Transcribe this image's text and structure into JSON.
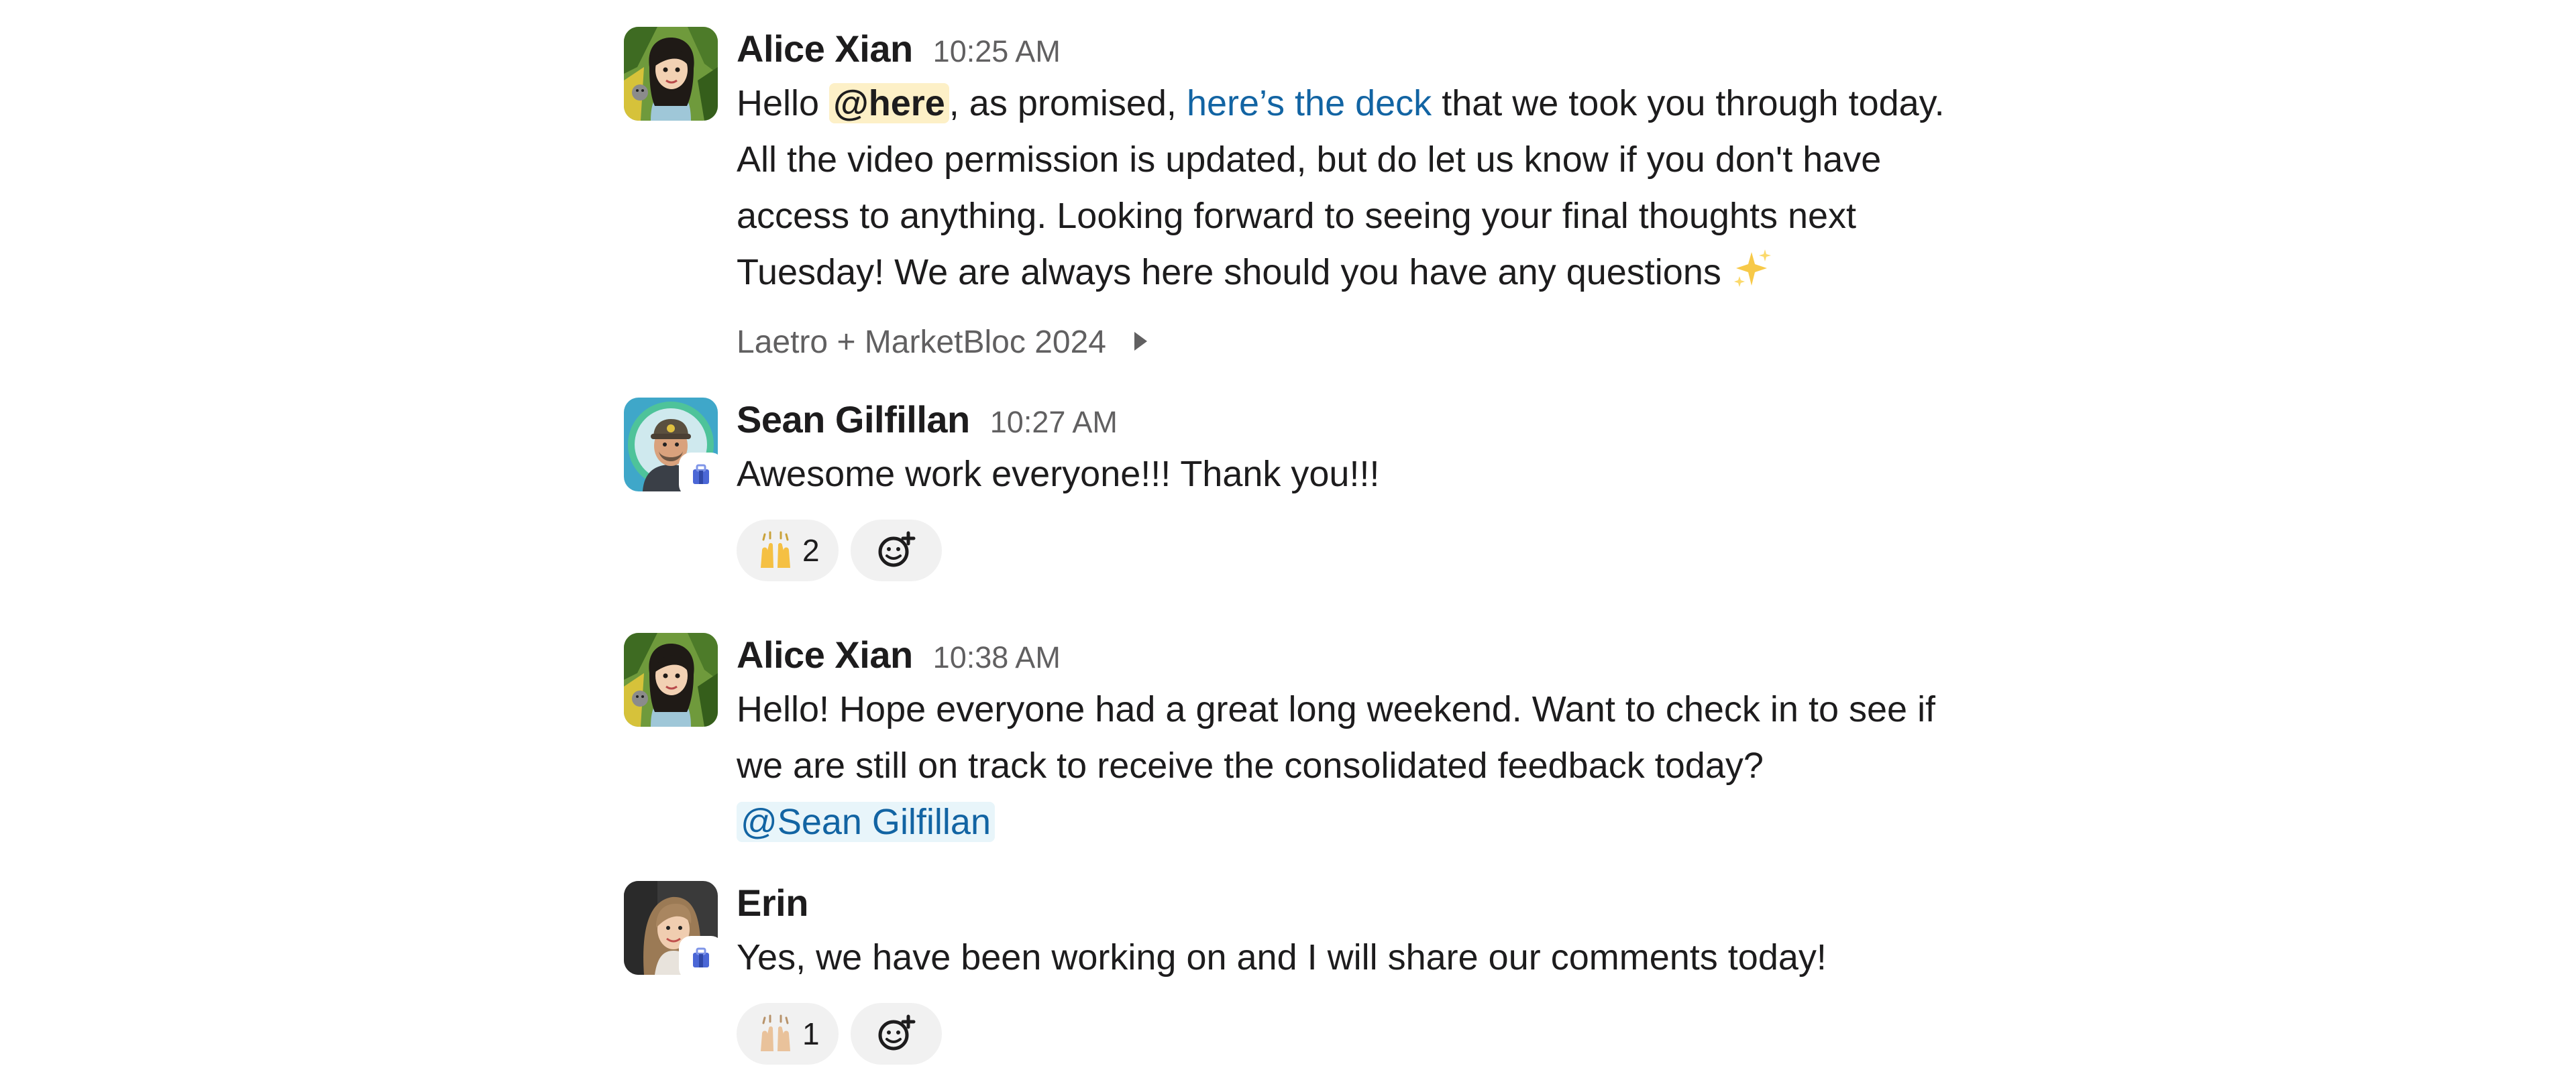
{
  "messages": [
    {
      "author": "Alice Xian",
      "time": "10:25 AM",
      "avatar": "alice-avatar",
      "text_pre": "Hello ",
      "mention": "@here",
      "text_mid": ", as promised, ",
      "link": "here’s the deck",
      "text_post": " that we took you through today. All the video permission is updated, but do let us know if you don't have access to anything. Looking forward to seeing your final thoughts next Tuesday! We are always here should you have any questions ",
      "emoji": "sparkles-icon",
      "attachment": "Laetro + MarketBloc 2024"
    },
    {
      "author": "Sean Gilfillan",
      "time": "10:27 AM",
      "avatar": "sean-avatar",
      "text": "Awesome work everyone!!! Thank you!!!",
      "reactions": [
        {
          "emoji": "raised-hands-icon",
          "count": "2"
        }
      ]
    },
    {
      "author": "Alice Xian",
      "time": "10:38 AM",
      "avatar": "alice-avatar",
      "text": "Hello! Hope everyone had a great long weekend. Want to check in to see if we are still on track to receive the consolidated feedback today?",
      "mention": "@Sean Gilfillan"
    },
    {
      "author": "Erin",
      "avatar": "erin-avatar",
      "text": "Yes, we have been working on and I will share our comments today!",
      "reactions": [
        {
          "emoji": "raised-hands-light-icon",
          "count": "1"
        }
      ]
    }
  ],
  "colors": {
    "text": "#1d1c1d",
    "muted": "#616061",
    "link": "#1264a3",
    "here_mention_bg": "#fdf0c7",
    "user_mention_bg": "#e8f5fa",
    "reaction_bg": "#f1f1f1"
  }
}
